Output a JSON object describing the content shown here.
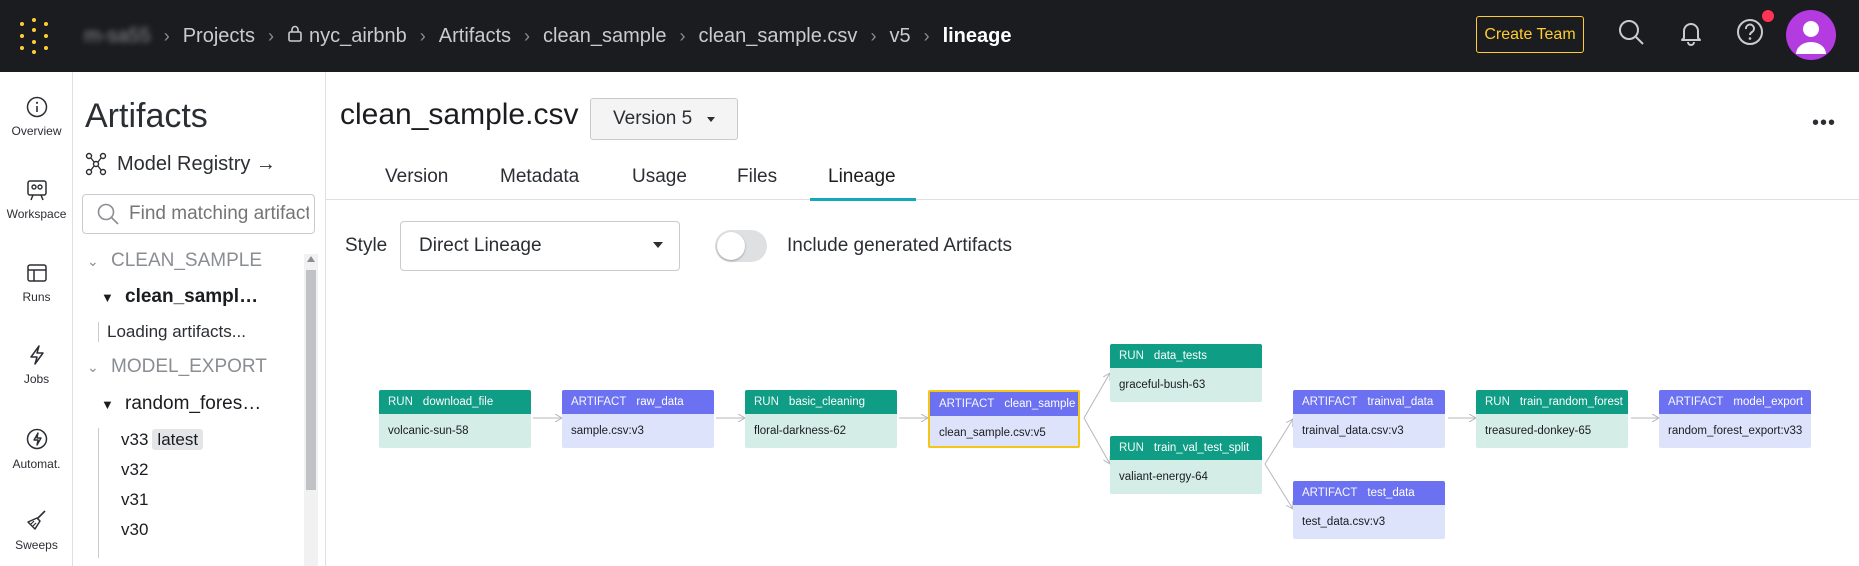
{
  "topbar": {
    "breadcrumbs": [
      {
        "label": "m-sa55",
        "blurred": true
      },
      {
        "label": "Projects"
      },
      {
        "label": "nyc_airbnb",
        "lock": true
      },
      {
        "label": "Artifacts"
      },
      {
        "label": "clean_sample"
      },
      {
        "label": "clean_sample.csv"
      },
      {
        "label": "v5"
      },
      {
        "label": "lineage",
        "current": true
      }
    ],
    "create_team_label": "Create Team",
    "accent": "#ffcc33"
  },
  "leftnav": [
    {
      "label": "Overview",
      "icon": "info-circle-icon"
    },
    {
      "label": "Workspace",
      "icon": "workspace-icon"
    },
    {
      "label": "Runs",
      "icon": "table-icon"
    },
    {
      "label": "Jobs",
      "icon": "lightning-icon"
    },
    {
      "label": "Automat.",
      "icon": "automation-icon"
    },
    {
      "label": "Sweeps",
      "icon": "broom-icon"
    }
  ],
  "artifacts_sidebar": {
    "title": "Artifacts",
    "model_registry_label": "Model Registry →",
    "search_placeholder": "Find matching artifacts",
    "groups": [
      {
        "name": "CLEAN_SAMPLE",
        "item": "clean_sampl…",
        "status": "Loading artifacts..."
      },
      {
        "name": "MODEL_EXPORT",
        "item": "random_fores…",
        "versions": [
          "v33",
          "v32",
          "v31",
          "v30"
        ],
        "latest_badge": "latest"
      }
    ]
  },
  "main": {
    "title": "clean_sample.csv",
    "version_select": "Version 5",
    "tabs": [
      "Version",
      "Metadata",
      "Usage",
      "Files",
      "Lineage"
    ],
    "active_tab": "Lineage",
    "style_label": "Style",
    "style_value": "Direct Lineage",
    "toggle_label": "Include generated Artifacts",
    "toggle_on": false
  },
  "lineage": {
    "nodes": [
      {
        "kind": "RUN",
        "name": "download_file",
        "value": "volcanic-sun-58"
      },
      {
        "kind": "ARTIFACT",
        "name": "raw_data",
        "value": "sample.csv:v3"
      },
      {
        "kind": "RUN",
        "name": "basic_cleaning",
        "value": "floral-darkness-62"
      },
      {
        "kind": "ARTIFACT",
        "name": "clean_sample",
        "value": "clean_sample.csv:v5",
        "selected": true
      },
      {
        "kind": "RUN",
        "name": "data_tests",
        "value": "graceful-bush-63"
      },
      {
        "kind": "RUN",
        "name": "train_val_test_split",
        "value": "valiant-energy-64"
      },
      {
        "kind": "ARTIFACT",
        "name": "trainval_data",
        "value": "trainval_data.csv:v3"
      },
      {
        "kind": "ARTIFACT",
        "name": "test_data",
        "value": "test_data.csv:v3"
      },
      {
        "kind": "RUN",
        "name": "train_random_forest",
        "value": "treasured-donkey-65"
      },
      {
        "kind": "ARTIFACT",
        "name": "model_export",
        "value": "random_forest_export:v33"
      }
    ],
    "colors": {
      "run": "#0f9d85",
      "artifact": "#6b71f0",
      "selected": "#f5c518"
    }
  }
}
